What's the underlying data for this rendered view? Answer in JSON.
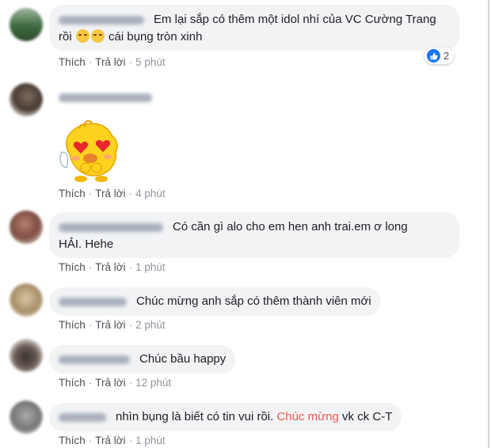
{
  "comments": [
    {
      "text_line1": "Em lại sắp có thêm một idol nhí của VC Cường Trang",
      "text_line2_pre": "rồi",
      "text_line2_post": "cái bụng tròn xinh",
      "emoji_icons": [
        "smiling-face-icon",
        "smiling-face-icon"
      ],
      "like": "Thích",
      "reply": "Trả lời",
      "time": "5 phút",
      "reaction_count": "2"
    },
    {
      "sticker": "heart-eyes-chick-sticker",
      "like": "Thích",
      "reply": "Trả lời",
      "time": "4 phút"
    },
    {
      "text_line1": "Có cần gì alo cho em hen anh trai.em ơ long",
      "text_line2": "HẢI. Hehe",
      "like": "Thích",
      "reply": "Trả lời",
      "time": "1 phút"
    },
    {
      "text": "Chúc mừng anh sắp có thêm thành viên mới",
      "like": "Thích",
      "reply": "Trả lời",
      "time": "2 phút"
    },
    {
      "text": "Chúc bầu happy",
      "like": "Thích",
      "reply": "Trả lời",
      "time": "12 phút"
    },
    {
      "text_pre": "nhìn bụng là biết có tin vui rồi.",
      "text_highlight": "Chúc mừng",
      "text_post": "vk ck C-T",
      "like": "Thích",
      "reply": "Trả lời",
      "time": "1 phút"
    }
  ],
  "colors": {
    "bubble": "#f2f3f5",
    "action_text": "#4b4f56",
    "meta_text": "#90949c",
    "highlight": "#f0584f",
    "like_blue": "#1877f2"
  }
}
